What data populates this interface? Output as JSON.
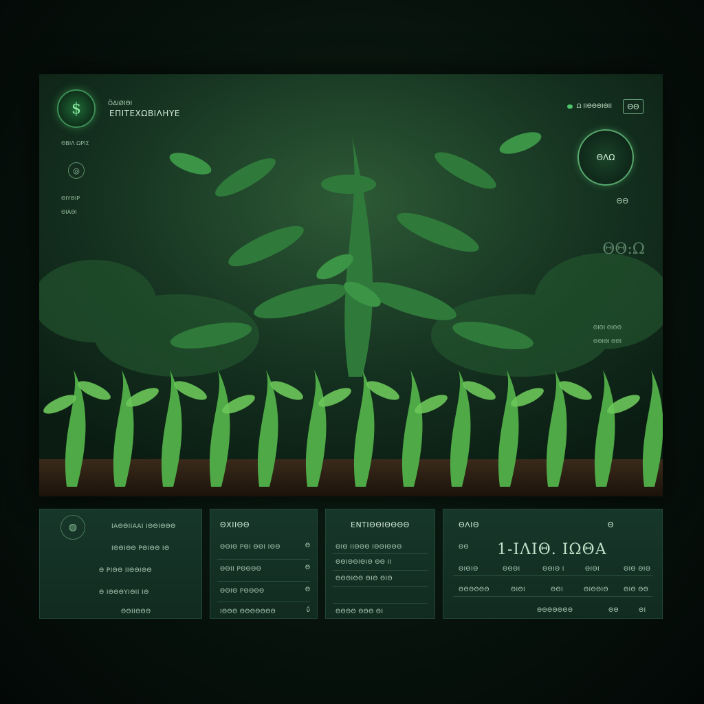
{
  "brand": {
    "pre": "Ö∆IØIΘI",
    "name": "ΕΠΙΤΕΧΩΒΙΛΗΥΕ",
    "logo_icon": "leaf-dollar-icon"
  },
  "sidebar": {
    "items": [
      {
        "label": "ΘΒΙΛ ΩΡΙΣ"
      },
      {
        "label": "Θ"
      },
      {
        "label": "ΘΙΥΘΙΡ"
      },
      {
        "label": "ΘΙΑΘΙ"
      }
    ],
    "icon": "globe-icon"
  },
  "top_status": {
    "label": "Ω ΙΙΘΘΘΙΘΙΙ",
    "chip": "ΘΘ",
    "dot_color": "#4ec46c"
  },
  "gauge": {
    "label": "ΘΛΩ",
    "sub": "ΘΘ",
    "big_read": "ΘΘ:Ω"
  },
  "right_lines": [
    "ΘΙΘΙ ΘΙΘΘ",
    "ΘΘΙΘΙ ΘΘΙ"
  ],
  "panels": {
    "p1": {
      "rows": [
        "ΙΑΘΘΙΙΑΑΙ ΙΘΘΙΘΘΘ",
        "ΙΘΘΙΘΘ ΡΘΙΘΘ  ΙΘ",
        "Θ  ΡΙΘΘ ΙΙΘΘΙΘΘ",
        "Θ  ΙΘΘΘΥΙΘΙΙ   ΙΘ",
        "ΘΘΙΙΘΘΘ"
      ],
      "icon": "globe-icon"
    },
    "p2": {
      "title": "ΘΧΙΙΘΘ",
      "rows": [
        {
          "label": "ΘΘΙΘ ΡΘΙ ΘΘΙ ΙΘΘ",
          "val": "Θ"
        },
        {
          "label": "ΘΘΙΙ ΡΘΘΘΘ",
          "val": "Θ"
        },
        {
          "label": "ΘΘΙΘ ΡΘΘΘΘ",
          "val": "Θ"
        },
        {
          "label": "ΙΘΘΘ ΘΘΘΘΘΘΘ",
          "val": "ΰ"
        }
      ]
    },
    "p3": {
      "title": "ΕΝΤΙΘΘΙΘΘΘΘ",
      "rows": [
        "ΘΙΘ ΙΙΘΘΘ ΙΘΘΙΘΘΘ",
        "ΘΘΙΘΘΙΘΙΘ   ΘΘ  ΙΙ",
        "ΘΘΘΙΘΘ   ΘΙΘ   ΘΙΘ",
        "ΘΘΘΘ   ΘΘΘ   ΘΙ"
      ]
    },
    "p4": {
      "title": "ΘΛΙΘ",
      "title_right": "Θ",
      "big": "1-ΙΛΙΘ.  ΙΩΘΑ",
      "row_label": "ΘΘ",
      "cols": [
        "ΘΙΘΙΘ",
        "ΘΘΘΙ",
        "ΘΘΙΘ Ι",
        "ΘΙΘΙ",
        "ΘΙΘ ΘΙΘ"
      ],
      "row2": [
        "ΘΘΘΘΘΘ",
        "ΘΙΘΙ",
        "ΘΘΙ",
        "ΘΙΘΘΙΘ",
        "ΘΙΘ ΘΘ"
      ],
      "footer": [
        "ΘΘΘΘΘΘΘ",
        "ΘΘ",
        "ΘΙ"
      ]
    }
  },
  "colors": {
    "accent": "#4ec46c",
    "panel": "#17372a",
    "leaf": "#3fa34a"
  }
}
